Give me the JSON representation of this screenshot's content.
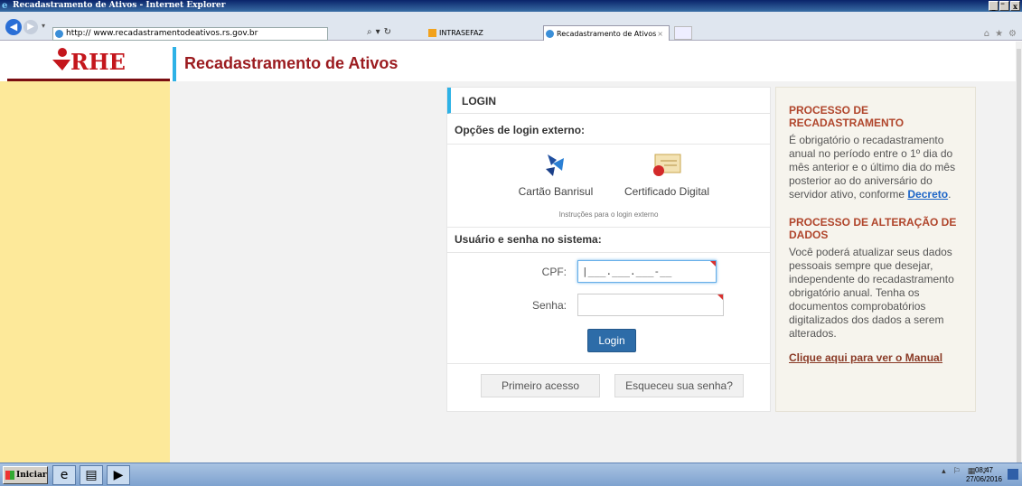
{
  "window": {
    "title": "Recadastramento de Ativos - Internet Explorer",
    "controls": [
      "_",
      "̅",
      "x"
    ]
  },
  "browser": {
    "address": "http:// www.recadastramentodeativos.rs.gov.br",
    "tabs": [
      {
        "label": "INTRASEFAZ",
        "active": false
      },
      {
        "label": "Recadastramento de Ativos",
        "active": true
      }
    ],
    "tab_close": "×"
  },
  "site": {
    "logo_text": "RHE",
    "header_title": "Recadastramento de Ativos"
  },
  "login": {
    "heading": "LOGIN",
    "external_label": "Opções de login externo:",
    "options": [
      {
        "label": "Cartão Banrisul",
        "icon": "banrisul-icon"
      },
      {
        "label": "Certificado Digital",
        "icon": "certificate-icon"
      }
    ],
    "external_hint": "Instruções para o login externo",
    "system_label": "Usuário e senha no sistema:",
    "cpf_label": "CPF:",
    "cpf_value": "|___.___.___-__",
    "password_label": "Senha:",
    "password_value": "",
    "login_button": "Login",
    "first_access_button": "Primeiro acesso",
    "forgot_button": "Esqueceu sua senha?"
  },
  "info": {
    "title1": "PROCESSO DE RECADASTRAMENTO",
    "text1": "É obrigatório o recadastramento anual no período entre o 1º dia do mês anterior e o último dia do mês posterior ao do aniversário do servidor ativo, conforme ",
    "link1": "Decreto",
    "text1_end": ".",
    "title2": "PROCESSO DE ALTERAÇÃO DE DADOS",
    "text2": "Você poderá atualizar seus dados pessoais sempre que desejar, independente do recadastramento obrigatório anual. Tenha os documentos comprobatórios digitalizados dos dados a serem alterados.",
    "manual_link": "Clique aqui para ver o Manual"
  },
  "taskbar": {
    "start_label": "Iniciar",
    "time": "08:47",
    "date": "27/06/2016"
  },
  "colors": {
    "brand_red": "#9b1b1f",
    "accent_blue": "#2eb2e6",
    "sidebar_yellow": "#fde99a",
    "button_blue": "#2d6ca8",
    "info_title": "#b0452b"
  }
}
